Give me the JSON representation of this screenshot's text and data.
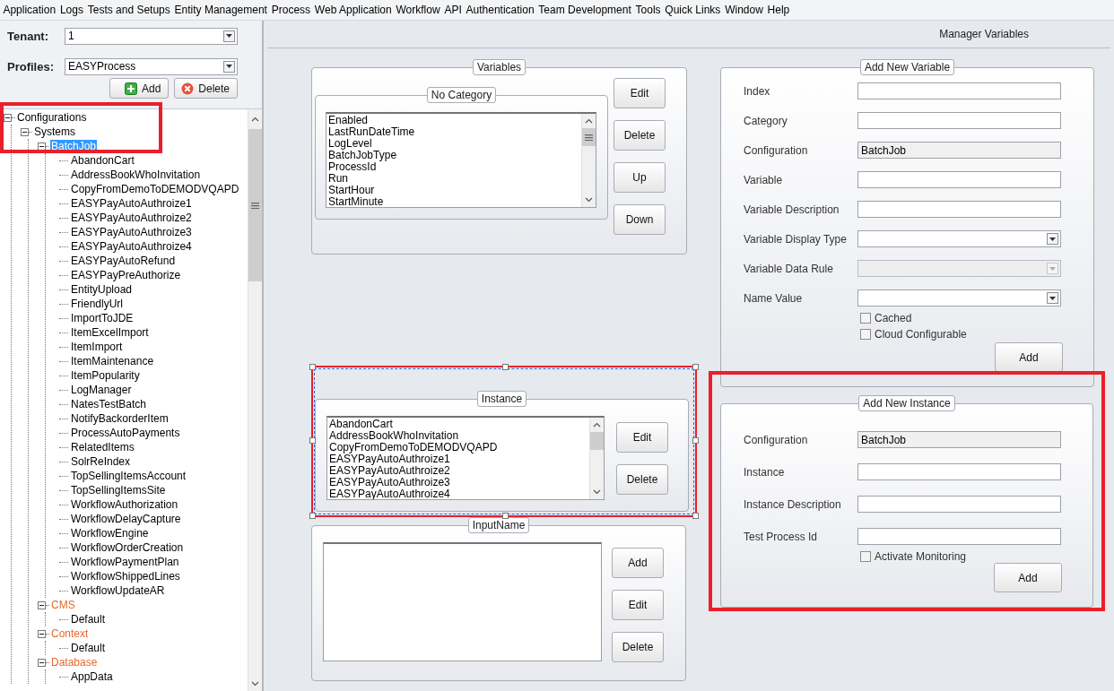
{
  "menu_bar": [
    "Application",
    "Logs",
    "Tests and Setups",
    "Entity Management",
    "Process",
    "Web Application",
    "Workflow",
    "API",
    "Authentication",
    "Team Development",
    "Tools",
    "Quick Links",
    "Window",
    "Help"
  ],
  "tenant": {
    "label": "Tenant:",
    "value": "1"
  },
  "profiles": {
    "label": "Profiles:",
    "value": "EASYProcess"
  },
  "profile_buttons": [
    {
      "label": "Add",
      "kind": "add"
    },
    {
      "label": "Delete",
      "kind": "delete"
    }
  ],
  "tree": [
    {
      "label": "Configurations",
      "selected": false,
      "expanded": true,
      "children": [
        {
          "label": "Systems",
          "selected": false,
          "expanded": true,
          "children": [
            {
              "label": "BatchJob",
              "selected": true,
              "expanded": true,
              "children": [
                {
                  "label": "AbandonCart",
                  "selected": false
                },
                {
                  "label": "AddressBookWhoInvitation",
                  "selected": false
                },
                {
                  "label": "CopyFromDemoToDEMODVQAPD",
                  "selected": false
                },
                {
                  "label": "EASYPayAutoAuthroize1",
                  "selected": false
                },
                {
                  "label": "EASYPayAutoAuthroize2",
                  "selected": false
                },
                {
                  "label": "EASYPayAutoAuthroize3",
                  "selected": false
                },
                {
                  "label": "EASYPayAutoAuthroize4",
                  "selected": false
                },
                {
                  "label": "EASYPayAutoRefund",
                  "selected": false
                },
                {
                  "label": "EASYPayPreAuthorize",
                  "selected": false
                },
                {
                  "label": "EntityUpload",
                  "selected": false
                },
                {
                  "label": "FriendlyUrl",
                  "selected": false
                },
                {
                  "label": "ImportToJDE",
                  "selected": false
                },
                {
                  "label": "ItemExcelImport",
                  "selected": false
                },
                {
                  "label": "ItemImport",
                  "selected": false
                },
                {
                  "label": "ItemMaintenance",
                  "selected": false
                },
                {
                  "label": "ItemPopularity",
                  "selected": false
                },
                {
                  "label": "LogManager",
                  "selected": false
                },
                {
                  "label": "NatesTestBatch",
                  "selected": false
                },
                {
                  "label": "NotifyBackorderItem",
                  "selected": false
                },
                {
                  "label": "ProcessAutoPayments",
                  "selected": false
                },
                {
                  "label": "RelatedItems",
                  "selected": false
                },
                {
                  "label": "SolrReIndex",
                  "selected": false
                },
                {
                  "label": "TopSellingItemsAccount",
                  "selected": false
                },
                {
                  "label": "TopSellingItemsSite",
                  "selected": false
                },
                {
                  "label": "WorkflowAuthorization",
                  "selected": false
                },
                {
                  "label": "WorkflowDelayCapture",
                  "selected": false
                },
                {
                  "label": "WorkflowEngine",
                  "selected": false
                },
                {
                  "label": "WorkflowOrderCreation",
                  "selected": false
                },
                {
                  "label": "WorkflowPaymentPlan",
                  "selected": false
                },
                {
                  "label": "WorkflowShippedLines",
                  "selected": false
                },
                {
                  "label": "WorkflowUpdateAR",
                  "selected": false
                }
              ]
            },
            {
              "label": "CMS",
              "selected": false,
              "expanded": true,
              "color": "#e8692a",
              "children": [
                {
                  "label": "Default",
                  "selected": false
                }
              ]
            },
            {
              "label": "Context",
              "selected": false,
              "expanded": true,
              "color": "#e8692a",
              "children": [
                {
                  "label": "Default",
                  "selected": false
                }
              ]
            },
            {
              "label": "Database",
              "selected": false,
              "expanded": true,
              "color": "#e8692a",
              "children": [
                {
                  "label": "AppData",
                  "selected": false
                }
              ]
            }
          ]
        }
      ]
    }
  ],
  "header": {
    "title": "Manager Variables"
  },
  "variables": {
    "title": "Variables",
    "category": {
      "title": "No Category",
      "items": [
        "Enabled",
        "LastRunDateTime",
        "LogLevel",
        "BatchJobType",
        "ProcessId",
        "Run",
        "StartHour",
        "StartMinute"
      ]
    },
    "buttons": [
      "Edit",
      "Delete",
      "Up",
      "Down"
    ]
  },
  "instance": {
    "title": "Instance",
    "items": [
      "AbandonCart",
      "AddressBookWhoInvitation",
      "CopyFromDemoToDEMODVQAPD",
      "EASYPayAutoAuthroize1",
      "EASYPayAutoAuthroize2",
      "EASYPayAutoAuthroize3",
      "EASYPayAutoAuthroize4"
    ],
    "buttons": [
      "Edit",
      "Delete"
    ]
  },
  "input_name": {
    "title": "InputName",
    "buttons": [
      "Add",
      "Edit",
      "Delete"
    ]
  },
  "add_new_variable": {
    "title": "Add New Variable",
    "fields": [
      {
        "label": "Index",
        "kind": "text",
        "disabled": false
      },
      {
        "label": "Category",
        "kind": "text",
        "disabled": false
      },
      {
        "label": "Configuration",
        "kind": "readonly",
        "value": "BatchJob",
        "disabled": false
      },
      {
        "label": "Variable",
        "kind": "text",
        "disabled": false
      },
      {
        "label": "Variable Description",
        "kind": "text",
        "disabled": false
      },
      {
        "label": "Variable Display Type",
        "kind": "combo",
        "disabled": false
      },
      {
        "label": "Variable Data Rule",
        "kind": "combo",
        "disabled": true
      },
      {
        "label": "Name Value",
        "kind": "combo",
        "disabled": false
      }
    ],
    "checkboxes": [
      {
        "label": "Cached",
        "checked": false
      },
      {
        "label": "Cloud Configurable",
        "checked": false
      }
    ],
    "button": "Add"
  },
  "add_new_instance": {
    "title": "Add New Instance",
    "fields": [
      {
        "label": "Configuration",
        "kind": "readonly",
        "value": "BatchJob",
        "disabled": false
      },
      {
        "label": "Instance",
        "kind": "text",
        "disabled": false
      },
      {
        "label": "Instance Description",
        "kind": "text",
        "disabled": false
      },
      {
        "label": "Test Process Id",
        "kind": "text",
        "disabled": false
      }
    ],
    "checkboxes": [
      {
        "label": "Activate Monitoring",
        "checked": false
      }
    ],
    "button": "Add"
  }
}
